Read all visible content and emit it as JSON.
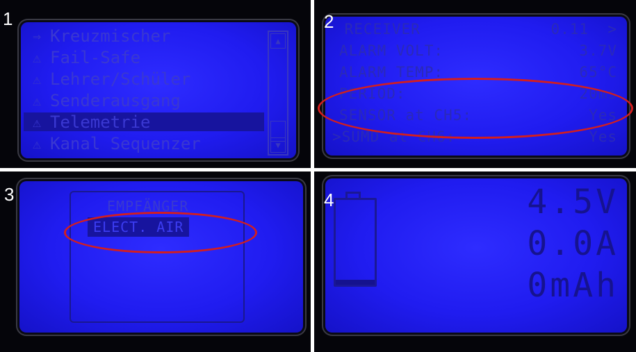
{
  "panels": [
    {
      "number": "1"
    },
    {
      "number": "2"
    },
    {
      "number": "3"
    },
    {
      "number": "4"
    }
  ],
  "menu": {
    "items": [
      {
        "icon": "arrow-icon",
        "glyph": "⇒",
        "label": "Kreuzmischer"
      },
      {
        "icon": "warning-icon",
        "glyph": "⚠",
        "label": "Fail-Safe"
      },
      {
        "icon": "warning-icon",
        "glyph": "⚠",
        "label": "Lehrer/Schüler"
      },
      {
        "icon": "warning-icon",
        "glyph": "⚠",
        "label": "Senderausgang"
      },
      {
        "icon": "warning-icon",
        "glyph": "⚠",
        "label": "Telemetrie"
      },
      {
        "icon": "warning-icon",
        "glyph": "⚠",
        "label": "Kanal Sequenzer"
      }
    ],
    "selected_index": 4,
    "scroll_up": "▲",
    "scroll_down": "▼"
  },
  "receiver": {
    "rows": [
      {
        "label": " RECEIVER",
        "value": "0.11  >"
      },
      {
        "label": "ALARM VOLT:",
        "value": "3.7V"
      },
      {
        "label": "ALARM TEMP:",
        "value": "65°C"
      },
      {
        "label": "PERIOD:",
        "value": "20ms"
      },
      {
        "label": "SENSOR at CH5:",
        "value": "Yes"
      },
      {
        "label": ">SUMD at CH6:",
        "value": "Yes"
      }
    ]
  },
  "device_select": {
    "items": [
      "EMPFÄNGER",
      "ELECT. AIR"
    ],
    "selected_index": 1
  },
  "telemetry": {
    "voltage": "4.5V",
    "current": "0.0A",
    "capacity": "0mAh",
    "battery_level": 0.06
  },
  "colors": {
    "highlight": "#d41e1e",
    "lcd_blue": "#201cf0"
  }
}
